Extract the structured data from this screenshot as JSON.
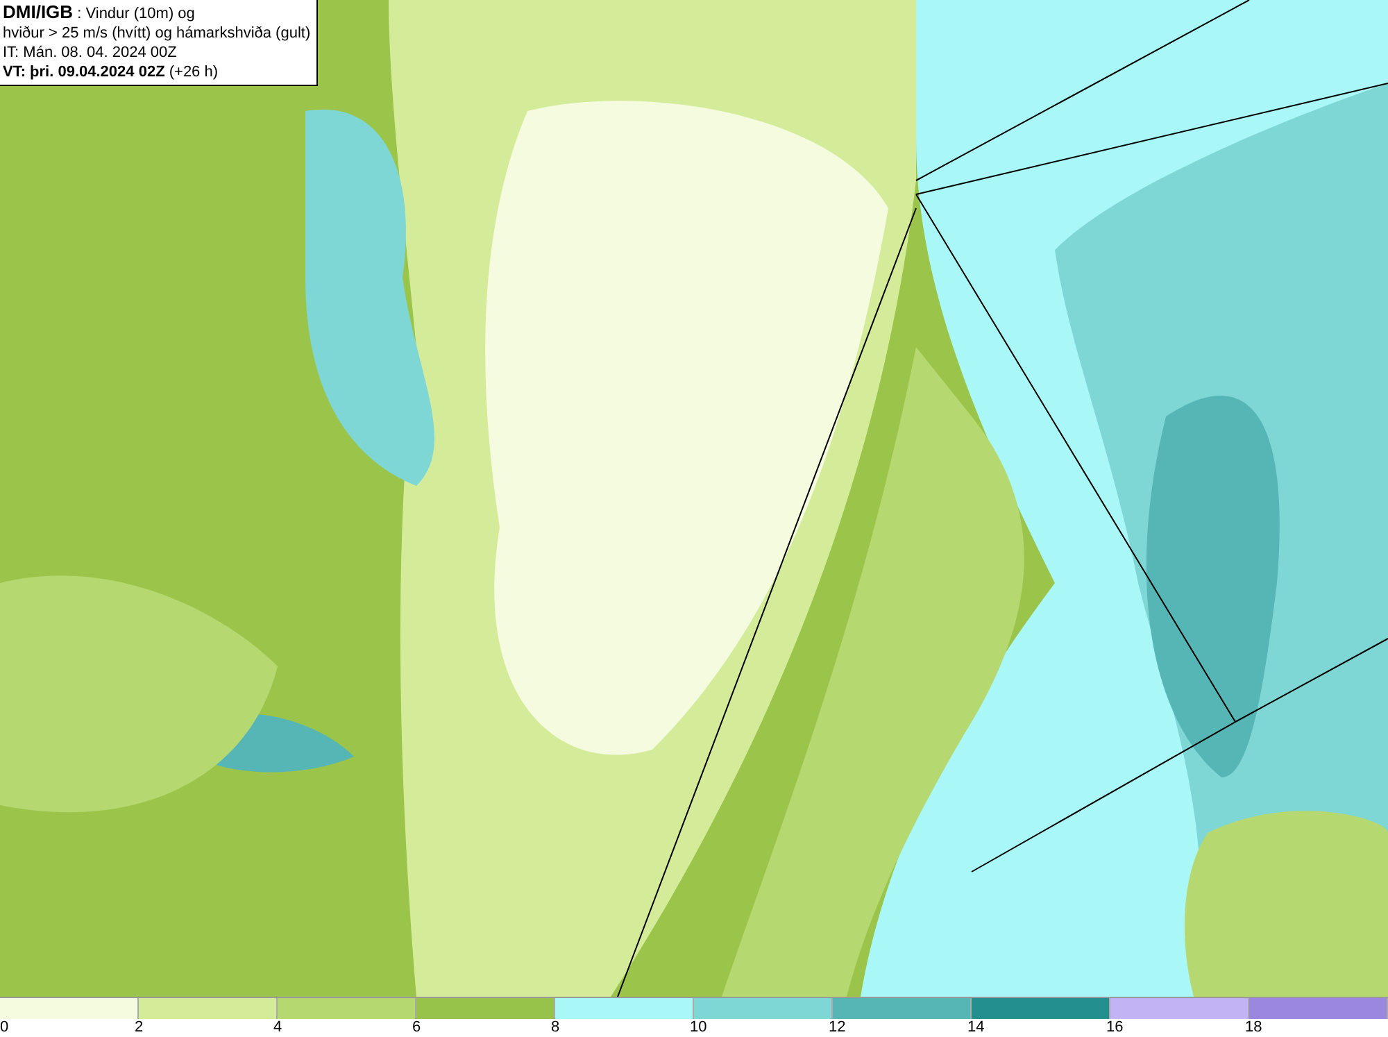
{
  "info": {
    "lines": [
      "**DMI/IGB** : Vindur (10m) og",
      "hviður > 25 m/s (hvítt) og hámarkshviða (gult)",
      "IT: Mán. 08. 04. 2024 00Z",
      "**VT: þri. 09.04.2024 02Z** (+26 h)"
    ]
  },
  "legend": {
    "bins": [
      {
        "label": "0",
        "color": "#f4fbde"
      },
      {
        "label": "2",
        "color": "#d4ec9a"
      },
      {
        "label": "4",
        "color": "#b5d970"
      },
      {
        "label": "6",
        "color": "#98c34a"
      },
      {
        "label": "8",
        "color": "#aaf7f7"
      },
      {
        "label": "10",
        "color": "#7fd7d5"
      },
      {
        "label": "12",
        "color": "#56b6b6"
      },
      {
        "label": "14",
        "color": "#248f8f"
      },
      {
        "label": "16",
        "color": "#c2b3f5"
      },
      {
        "label": "18",
        "color": "#9c87df"
      }
    ]
  }
}
